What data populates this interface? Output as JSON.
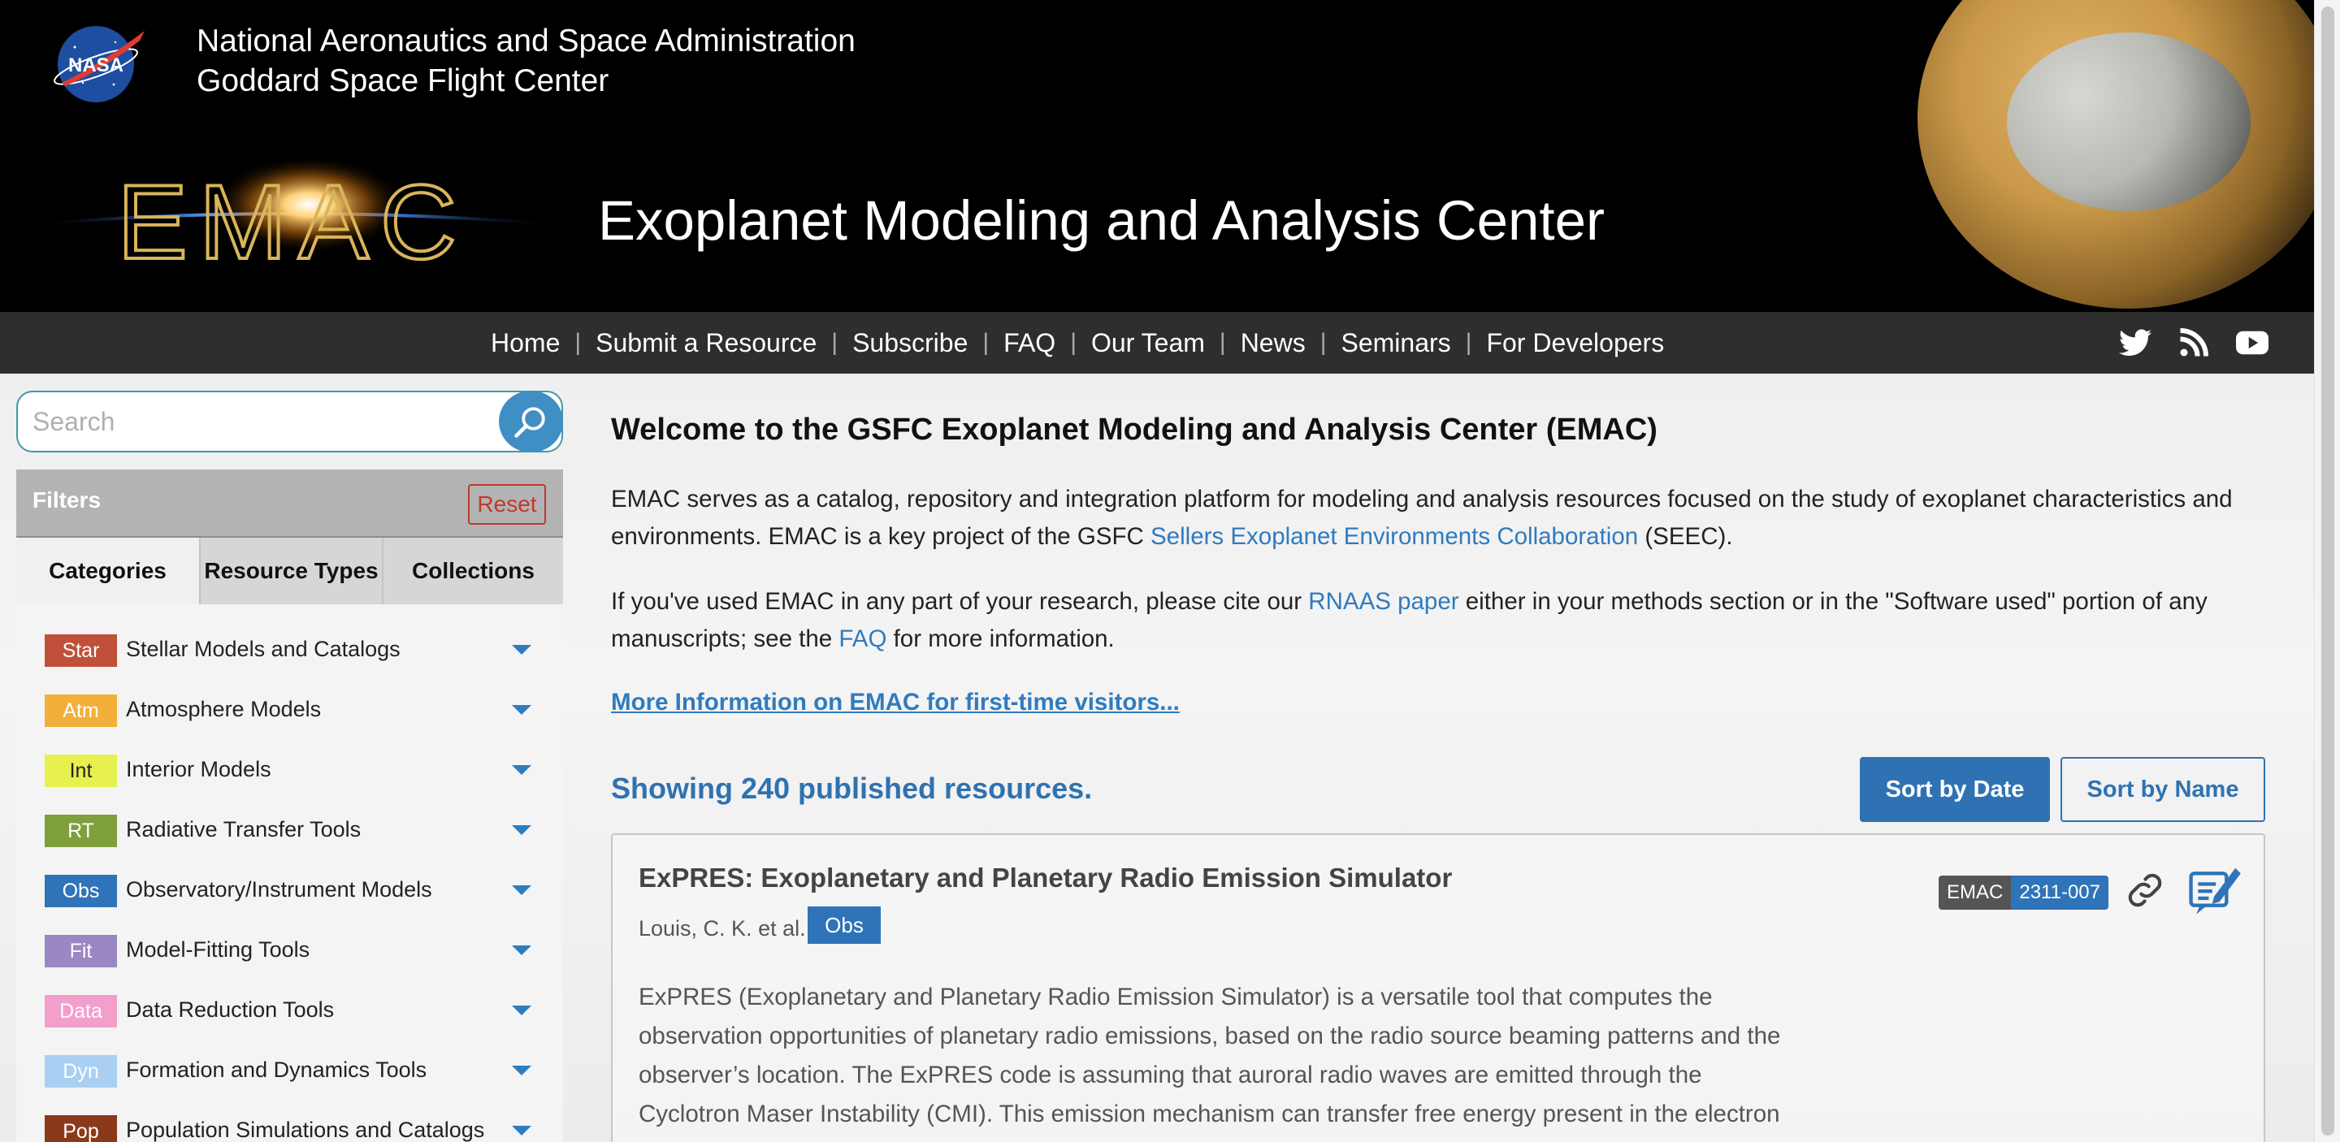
{
  "header": {
    "org_line1": "National Aeronautics and Space Administration",
    "org_line2": "Goddard Space Flight Center",
    "nasa_logo_text": "NASA",
    "emac_logo_text": "EMAC",
    "site_title": "Exoplanet Modeling and Analysis Center"
  },
  "nav": {
    "items": [
      {
        "label": "Home"
      },
      {
        "label": "Submit a Resource"
      },
      {
        "label": "Subscribe"
      },
      {
        "label": "FAQ"
      },
      {
        "label": "Our Team"
      },
      {
        "label": "News"
      },
      {
        "label": "Seminars"
      },
      {
        "label": "For Developers"
      }
    ],
    "separator": "|",
    "social_icons": [
      "twitter-icon",
      "rss-icon",
      "youtube-icon"
    ]
  },
  "sidebar": {
    "search": {
      "placeholder": "Search",
      "value": ""
    },
    "filters_label": "Filters",
    "reset_label": "Reset",
    "tabs": [
      {
        "label": "Categories",
        "active": true
      },
      {
        "label": "Resource Types",
        "active": false
      },
      {
        "label": "Collections",
        "active": false
      }
    ],
    "categories": [
      {
        "badge": "Star",
        "label": "Stellar Models and Catalogs",
        "color": "#c0503a",
        "text_color": "#ffffff"
      },
      {
        "badge": "Atm",
        "label": "Atmosphere Models",
        "color": "#f2b03a",
        "text_color": "#ffffff"
      },
      {
        "badge": "Int",
        "label": "Interior Models",
        "color": "#e6f04e",
        "text_color": "#222222"
      },
      {
        "badge": "RT",
        "label": "Radiative Transfer Tools",
        "color": "#7f9f3c",
        "text_color": "#ffffff"
      },
      {
        "badge": "Obs",
        "label": "Observatory/Instrument Models",
        "color": "#2f74b8",
        "text_color": "#ffffff"
      },
      {
        "badge": "Fit",
        "label": "Model-Fitting Tools",
        "color": "#9a87c4",
        "text_color": "#ffffff"
      },
      {
        "badge": "Data",
        "label": "Data Reduction Tools",
        "color": "#f29fcb",
        "text_color": "#ffffff"
      },
      {
        "badge": "Dyn",
        "label": "Formation and Dynamics Tools",
        "color": "#a9cff2",
        "text_color": "#ffffff"
      },
      {
        "badge": "Pop",
        "label": "Population Simulations and Catalogs",
        "color": "#8a3a1a",
        "text_color": "#ffffff"
      }
    ]
  },
  "main": {
    "welcome_title": "Welcome to the GSFC Exoplanet Modeling and Analysis Center (EMAC)",
    "para1_a": "EMAC serves as a catalog, repository and integration platform for modeling and analysis resources focused on the study of exoplanet characteristics and environments. EMAC is a key project of the GSFC ",
    "para1_link": "Sellers Exoplanet Environments Collaboration",
    "para1_b": " (SEEC).",
    "para2_a": "If you've used EMAC in any part of your research, please cite our ",
    "para2_link1": "RNAAS paper",
    "para2_b": " either in your methods section or in the \"Software used\" portion of any manuscripts; see the ",
    "para2_link2": "FAQ",
    "para2_c": " for more information.",
    "more_info_link": "More Information on EMAC for first-time visitors...",
    "showing_count": "Showing 240 published resources.",
    "sort_date_label": "Sort by Date",
    "sort_name_label": "Sort by Name",
    "card": {
      "title": "ExPRES: Exoplanetary and Planetary Radio Emission Simulator",
      "authors": "Louis, C. K. et al.",
      "tag": "Obs",
      "emac_label": "EMAC",
      "emac_id": "2311-007",
      "description": "ExPRES (Exoplanetary and Planetary Radio Emission Simulator) is a versatile tool that computes the observation opportunities of planetary radio emissions, based on the radio source beaming patterns and the observer’s location. The ExPRES code is assuming that auroral radio waves are emitted through the Cyclotron Maser Instability (CMI). This emission mechanism can transfer free energy present in the electron"
    }
  }
}
